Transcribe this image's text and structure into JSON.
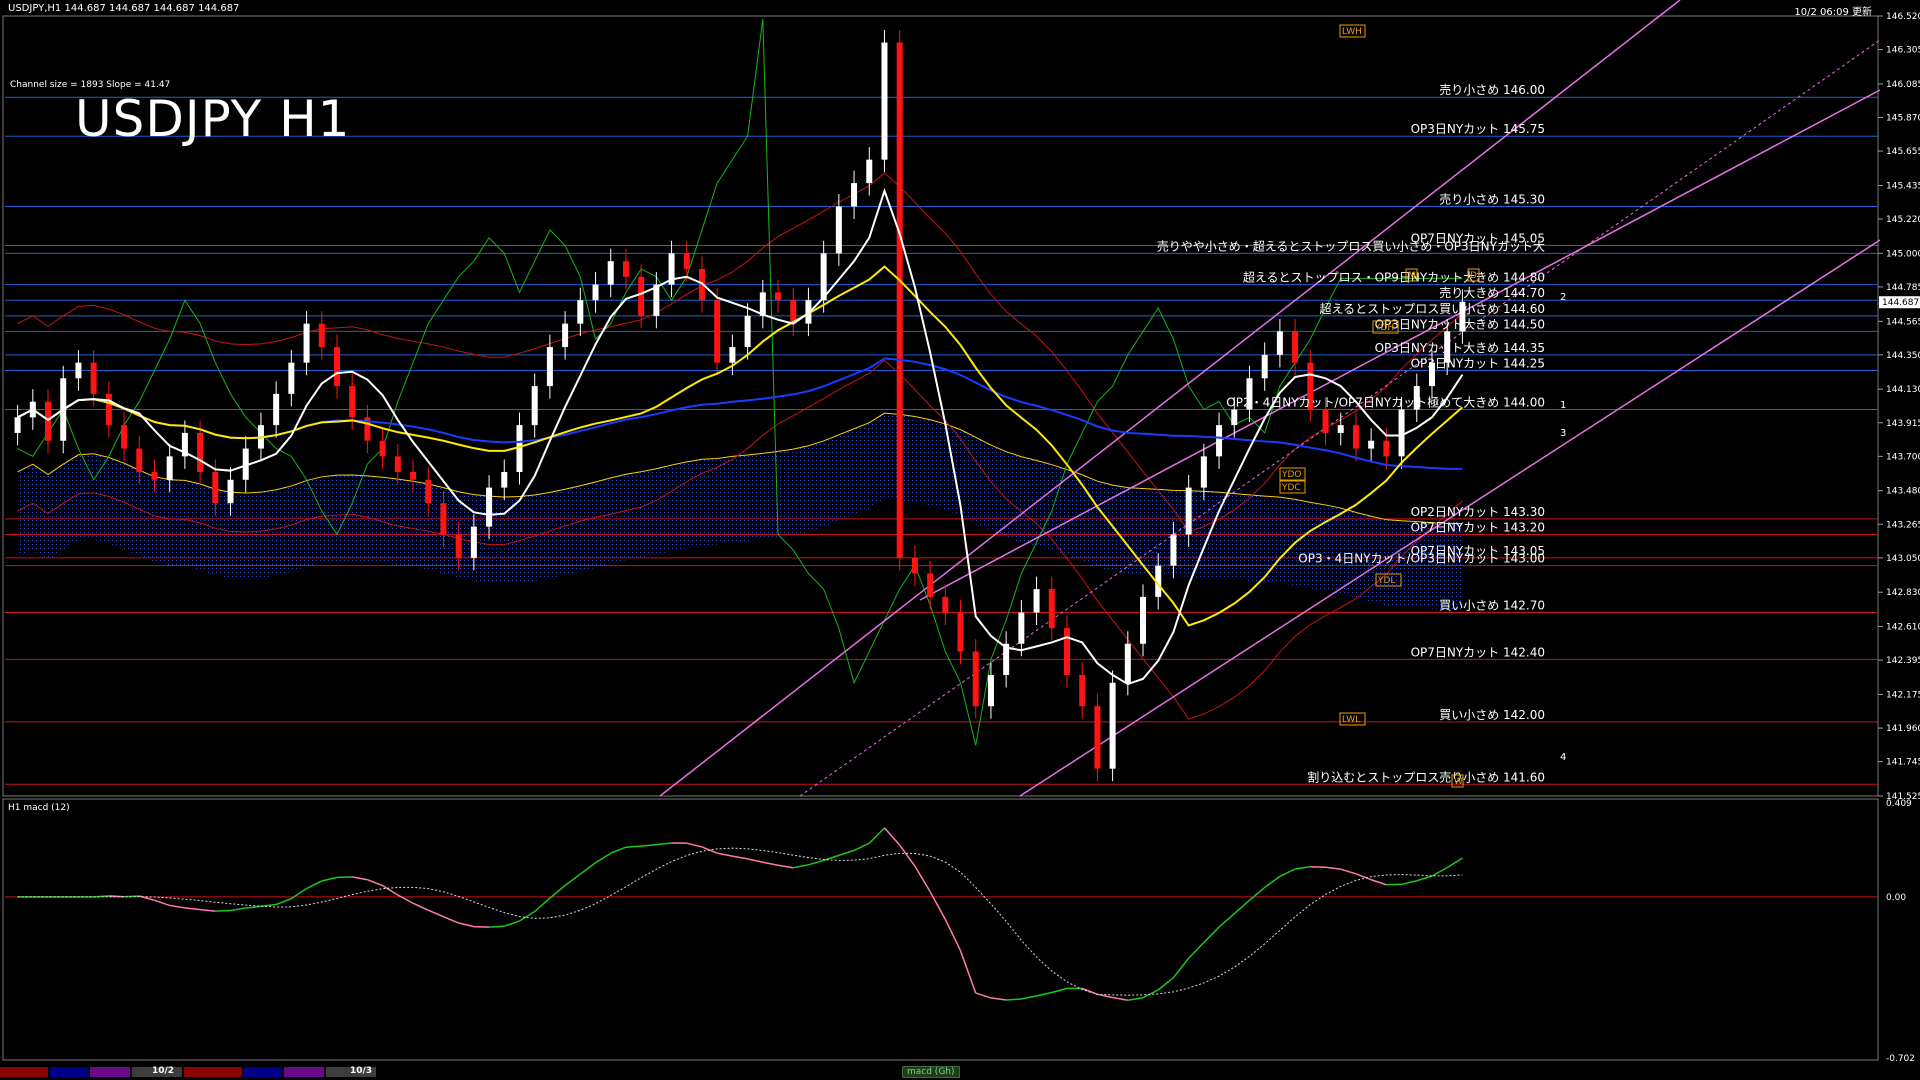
{
  "header": {
    "symbol_line": "USDJPY,H1  144.687 144.687 144.687 144.687",
    "datetime": "10/2 06:09 更新",
    "channel_info": "Channel size = 1893 Slope = 41.47",
    "big_title": "USDJPY H1",
    "subwindow_label": "H1 macd (12)",
    "macd_tab": "macd (Gh)",
    "date_tabs": [
      "10/2",
      "10/3"
    ]
  },
  "colors": {
    "background": "#000000",
    "grid_blue": "#1e5fd4",
    "grid_red": "#c81414",
    "bull_candle": "#ffffff",
    "bear_candle": "#ff1414",
    "channel": "#e870e8",
    "ma_white": "#ffffff",
    "ma_yellow": "#ffea00",
    "ma_blue": "#1a3cff",
    "bollinger": "#c81414",
    "chikou": "#19b419",
    "cloud_upper": "#ffd000",
    "macd_green": "#1cc81c",
    "macd_pink": "#ff7ab4"
  },
  "chart_data": {
    "type": "candlestick",
    "title": "USDJPY H1",
    "ylim": [
      141.525,
      146.52
    ],
    "y_ticks": [
      "146.520",
      "146.305",
      "146.085",
      "145.870",
      "145.655",
      "145.435",
      "145.220",
      "145.000",
      "144.785",
      "144.565",
      "144.350",
      "144.130",
      "143.915",
      "143.700",
      "143.480",
      "143.265",
      "143.050",
      "142.830",
      "142.610",
      "142.395",
      "142.175",
      "141.960",
      "141.745",
      "141.525"
    ],
    "current_price": "144.687",
    "levels": [
      {
        "price": 146.0,
        "color": "blue",
        "label": "売り小さめ 146.00"
      },
      {
        "price": 145.75,
        "color": "blue",
        "label": "OP3日NYカット 145.75"
      },
      {
        "price": 145.3,
        "color": "blue",
        "label": "売り小さめ 145.30"
      },
      {
        "price": 145.05,
        "color": "blue",
        "label": "OP7日NYカット 145.05"
      },
      {
        "price": 145.0,
        "color": "blue",
        "label": "売りやや小さめ・超えるとストップロス買い小さめ・OP3日NYカット大"
      },
      {
        "price": 144.8,
        "color": "blue",
        "label": "超えるとストップロス・OP9日NYカット大きめ 144.80"
      },
      {
        "price": 144.7,
        "color": "blue",
        "label": "売り大きめ 144.70"
      },
      {
        "price": 144.6,
        "color": "blue",
        "label": "超えるとストップロス買い小さめ 144.60"
      },
      {
        "price": 144.5,
        "color": "blue",
        "label": "OP3日NYカット大きめ 144.50"
      },
      {
        "price": 144.35,
        "color": "blue",
        "label": "OP3日NYカット大きめ 144.35"
      },
      {
        "price": 144.25,
        "color": "blue",
        "label": "OP3日NYカット 144.25"
      },
      {
        "price": 144.0,
        "color": "blue",
        "label": "OP2・4日NYカット/OP7日NYカット極めて大きめ 144.00"
      },
      {
        "price": 143.3,
        "color": "red",
        "label": "OP2日NYカット 143.30"
      },
      {
        "price": 143.2,
        "color": "red",
        "label": "OP7日NYカット 143.20"
      },
      {
        "price": 143.05,
        "color": "red",
        "label": "OP7日NYカット 143.05"
      },
      {
        "price": 143.0,
        "color": "red",
        "label": "OP3・4日NYカット/OP3日NYカット 143.00"
      },
      {
        "price": 142.7,
        "color": "red",
        "label": "買い小さめ 142.70"
      },
      {
        "price": 142.4,
        "color": "red",
        "label": "OP7日NYカット 142.40"
      },
      {
        "price": 142.0,
        "color": "red",
        "label": "買い小さめ 142.00"
      },
      {
        "price": 141.6,
        "color": "red",
        "label": "割り込むとストップロス売り小さめ 141.60"
      }
    ],
    "zone_labels": [
      "LWH",
      "LWL",
      "YDH",
      "YDO",
      "YDC",
      "YDL",
      "W",
      "M",
      "D"
    ],
    "channel_numbers": [
      "2",
      "3",
      "1",
      "4"
    ],
    "candles_close": [
      143.95,
      144.05,
      143.8,
      144.2,
      144.3,
      144.1,
      143.9,
      143.75,
      143.6,
      143.55,
      143.7,
      143.85,
      143.6,
      143.4,
      143.55,
      143.75,
      143.9,
      144.1,
      144.3,
      144.55,
      144.4,
      144.15,
      143.95,
      143.8,
      143.7,
      143.6,
      143.55,
      143.4,
      143.2,
      143.05,
      143.25,
      143.5,
      143.6,
      143.9,
      144.15,
      144.4,
      144.55,
      144.7,
      144.8,
      144.95,
      144.85,
      144.6,
      144.8,
      145.0,
      144.9,
      144.7,
      144.3,
      144.4,
      144.6,
      144.75,
      144.7,
      144.55,
      144.7,
      145.0,
      145.3,
      145.45,
      145.6,
      146.35,
      143.05,
      142.95,
      142.8,
      142.7,
      142.45,
      142.1,
      142.3,
      142.5,
      142.7,
      142.85,
      142.6,
      142.3,
      142.1,
      141.7,
      142.25,
      142.5,
      142.8,
      143.0,
      143.2,
      143.5,
      143.7,
      143.9,
      144.0,
      144.2,
      144.35,
      144.5,
      144.3,
      144.0,
      143.85,
      143.9,
      143.75,
      143.8,
      143.7,
      144.0,
      144.15,
      144.3,
      144.5,
      144.69
    ],
    "macd": {
      "zero": 0.0,
      "ylim": [
        -0.702,
        0.409
      ],
      "y_ticks": [
        "0.409",
        "0.00",
        "-0.702"
      ]
    }
  }
}
